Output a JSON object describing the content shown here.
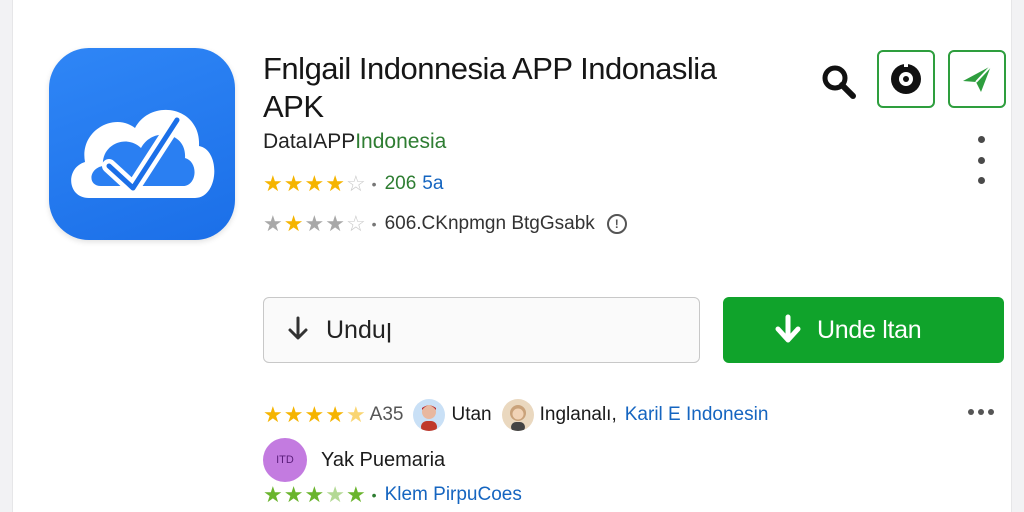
{
  "app": {
    "title": "Fnlgail Indonnesia APP Indonaslia APK",
    "developer_prefix": "DataIAPP",
    "developer_name": "Indonesia"
  },
  "ratings": {
    "row1": {
      "stars": 4,
      "meta": "206",
      "meta2": "5a"
    },
    "row2": {
      "stars": 3,
      "meta": "606.CKnpmgn BtgGsabk",
      "info_icon": "info-icon"
    }
  },
  "actions": {
    "search_icon": "search-icon",
    "btn1_icon": "settings-icon",
    "btn2_icon": "send-icon",
    "more_icon": "more-vert-icon"
  },
  "buttons": {
    "outline_label": "Unduן",
    "primary_label": "Unde ltan"
  },
  "reviews": {
    "row1": {
      "count": "A35",
      "name1": "Utan",
      "name2": "Inglanalı,",
      "name3": "Karil Ε Indonesin"
    },
    "row2": {
      "avatar_text": "ITD",
      "name": "Yak Puemaria"
    },
    "row3": {
      "meta": "Klem PirpuCoes"
    }
  },
  "colors": {
    "primary_green": "#10a32b",
    "accent_green": "#2e9e3e",
    "icon_blue": "#1b6fe8",
    "star_yellow": "#f5b400",
    "link_blue": "#1565c0"
  }
}
